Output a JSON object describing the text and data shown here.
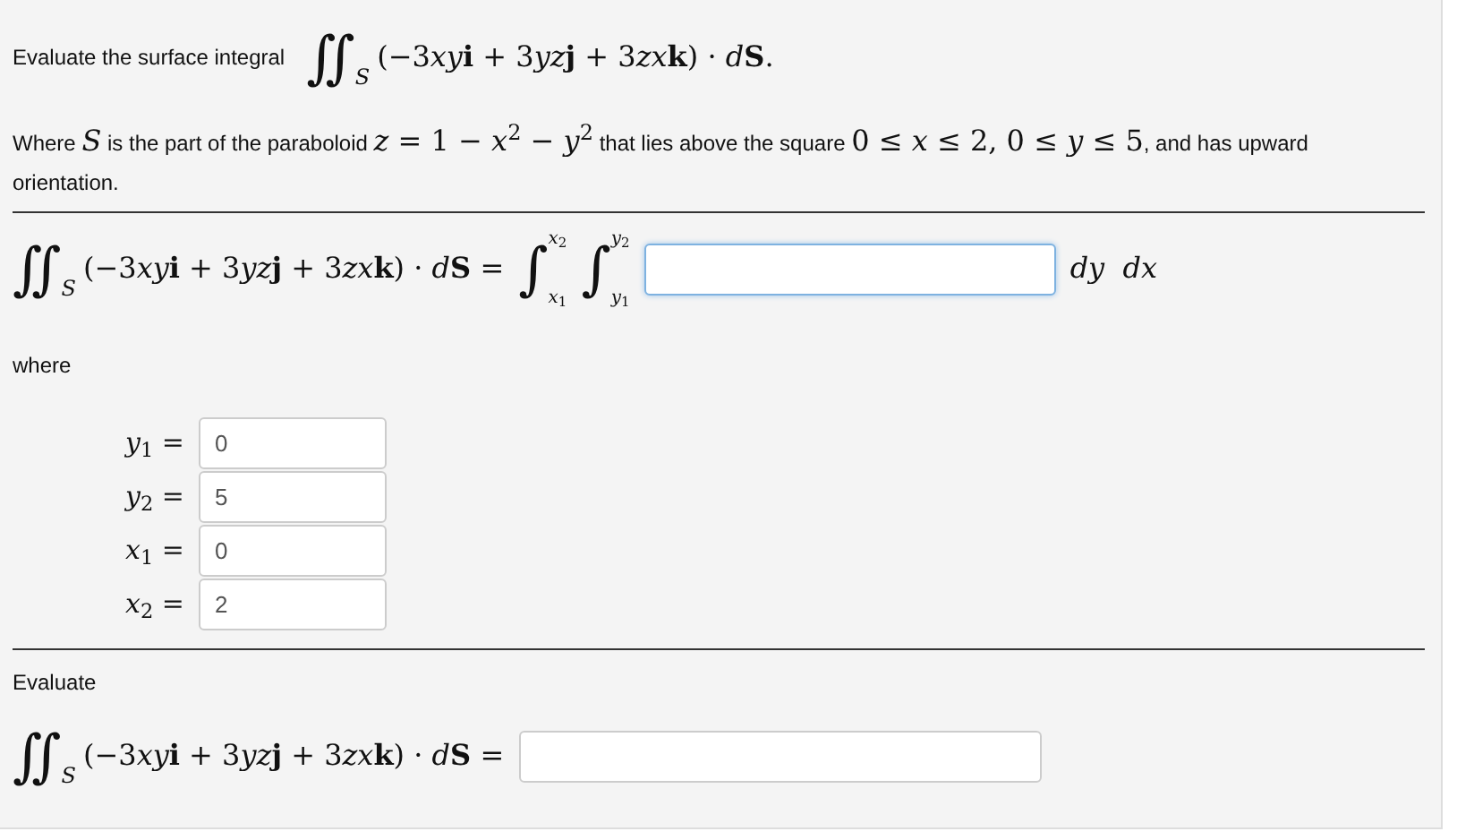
{
  "prompt": {
    "label": "Evaluate the surface integral",
    "integral": "∬",
    "subscript": "S",
    "expression": [
      {
        "kind": "roman",
        "text": "(−3"
      },
      {
        "kind": "italic",
        "text": "xy"
      },
      {
        "kind": "bold",
        "text": "i"
      },
      {
        "kind": "roman",
        "text": " + 3"
      },
      {
        "kind": "italic",
        "text": "yz"
      },
      {
        "kind": "bold",
        "text": "j"
      },
      {
        "kind": "roman",
        "text": " + 3"
      },
      {
        "kind": "italic",
        "text": "zx"
      },
      {
        "kind": "bold",
        "text": "k"
      },
      {
        "kind": "roman",
        "text": ") · "
      },
      {
        "kind": "italic",
        "text": "d"
      },
      {
        "kind": "bold",
        "text": "S"
      },
      {
        "kind": "roman",
        "text": "."
      }
    ]
  },
  "description": [
    {
      "kind": "text",
      "text": "Where "
    },
    {
      "kind": "math",
      "text": "*S*"
    },
    {
      "kind": "text",
      "text": " is the part of the paraboloid "
    },
    {
      "kind": "math",
      "text": "*z* = 1 − *x*$^{2}$ − *y*$^{2}$"
    },
    {
      "kind": "text",
      "text": " that lies above the square "
    },
    {
      "kind": "math",
      "text": "0 ≤ *x* ≤ 2,  0 ≤ *y* ≤ 5"
    },
    {
      "kind": "text",
      "text": ", and has upward orientation."
    }
  ],
  "setup": {
    "integral": "∬",
    "subscript": "S",
    "expression": [
      {
        "kind": "roman",
        "text": "(−3"
      },
      {
        "kind": "italic",
        "text": "xy"
      },
      {
        "kind": "bold",
        "text": "i"
      },
      {
        "kind": "roman",
        "text": " + 3"
      },
      {
        "kind": "italic",
        "text": "yz"
      },
      {
        "kind": "bold",
        "text": "j"
      },
      {
        "kind": "roman",
        "text": " + 3"
      },
      {
        "kind": "italic",
        "text": "zx"
      },
      {
        "kind": "bold",
        "text": "k"
      },
      {
        "kind": "roman",
        "text": ") · "
      },
      {
        "kind": "italic",
        "text": "d"
      },
      {
        "kind": "bold",
        "text": "S"
      },
      {
        "kind": "roman",
        "text": " ="
      }
    ],
    "bounds": [
      {
        "sign": "∫",
        "upper": "*x*$_{2}$",
        "lower": "*x*$_{1}$"
      },
      {
        "sign": "∫",
        "upper": "*y*$_{2}$",
        "lower": "*y*$_{1}$"
      }
    ],
    "focused": true,
    "differentials": "*dy*  *dx*"
  },
  "where_label": "where",
  "limits": [
    {
      "label": "*y*$_{1}$ =",
      "value": "0"
    },
    {
      "label": "*y*$_{2}$ =",
      "value": "5"
    },
    {
      "label": "*x*$_{1}$ =",
      "value": "0"
    },
    {
      "label": "*x*$_{2}$ =",
      "value": "2"
    }
  ],
  "evaluate": {
    "label": "Evaluate",
    "integral": "∬",
    "subscript": "S",
    "expression": [
      {
        "kind": "roman",
        "text": "(−3"
      },
      {
        "kind": "italic",
        "text": "xy"
      },
      {
        "kind": "bold",
        "text": "i"
      },
      {
        "kind": "roman",
        "text": " + 3"
      },
      {
        "kind": "italic",
        "text": "yz"
      },
      {
        "kind": "bold",
        "text": "j"
      },
      {
        "kind": "roman",
        "text": " + 3"
      },
      {
        "kind": "italic",
        "text": "zx"
      },
      {
        "kind": "bold",
        "text": "k"
      },
      {
        "kind": "roman",
        "text": ") · "
      },
      {
        "kind": "italic",
        "text": "d"
      },
      {
        "kind": "bold",
        "text": "S"
      },
      {
        "kind": "roman",
        "text": " ="
      }
    ]
  }
}
